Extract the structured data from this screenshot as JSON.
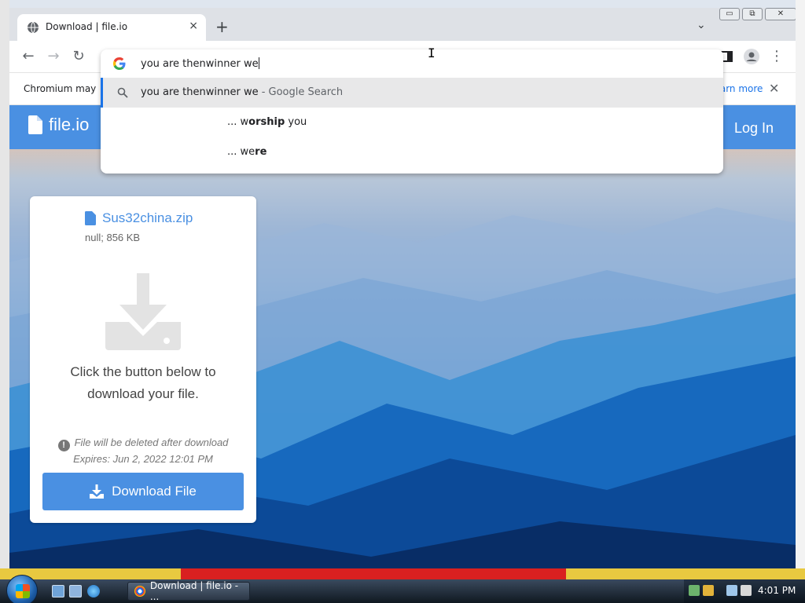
{
  "browser": {
    "tab_title": "Download | file.io",
    "tab_close": "×",
    "new_tab": "+",
    "tab_search": "⌄"
  },
  "window_controls": {
    "minimize": "▭",
    "maximize": "⧉",
    "close": "✕"
  },
  "toolbar": {
    "back": "←",
    "forward": "→",
    "reload": "↻",
    "menu": "⋮"
  },
  "infobar": {
    "message": "Chromium may",
    "link": "Learn more",
    "close": "✕"
  },
  "omnibox": {
    "value": "you are thenwinner we",
    "suggestions": [
      {
        "icon": "search-icon",
        "prefix": "",
        "text": "you are thenwinner we",
        "suffix": " - Google Search",
        "bold": ""
      },
      {
        "icon": "",
        "prefix": "... w",
        "bold": "orship",
        "text": " you"
      },
      {
        "icon": "",
        "prefix": "... we",
        "bold": "re",
        "text": ""
      }
    ]
  },
  "site": {
    "logo": "file.io",
    "login": "Log In",
    "file_name": "Sus32china.zip",
    "file_meta": "null; 856 KB",
    "prompt_line1": "Click the button below to",
    "prompt_line2": "download your file.",
    "note_line1": "File will be deleted after download",
    "note_line2": "Expires: Jun 2, 2022 12:01 PM",
    "download_button": "Download File",
    "accent_color": "#4a90e2"
  },
  "taskbar": {
    "task_label": "Download | file.io - ...",
    "clock": "4:01 PM"
  }
}
